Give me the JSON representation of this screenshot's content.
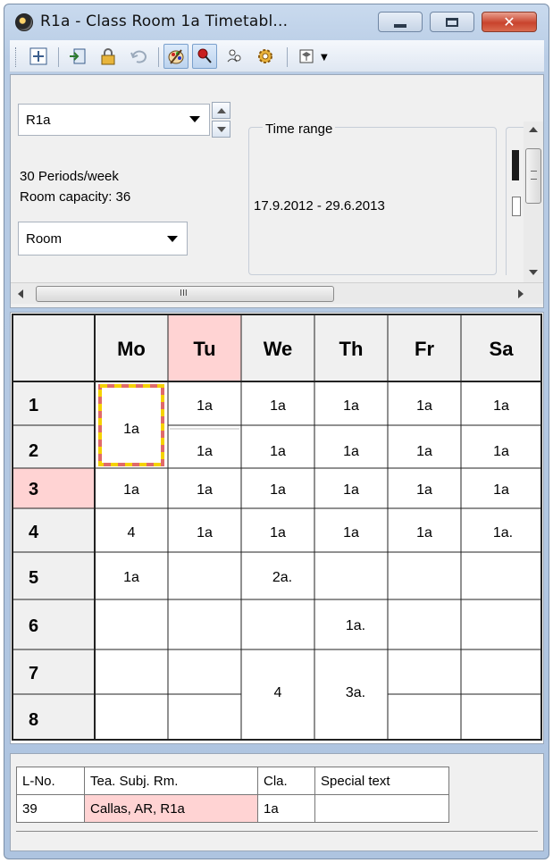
{
  "window": {
    "title": "R1a - Class Room 1a  Timetabl...",
    "buttons": {
      "minimize": "–",
      "maximize": "□",
      "close": "✕"
    }
  },
  "toolbar": {
    "icons": [
      "grid-plus-icon",
      "export-icon",
      "lock-icon",
      "undo-icon",
      "color-palette-icon",
      "pin-icon",
      "users-icon",
      "gear-icon",
      "hat-icon"
    ]
  },
  "room": {
    "selected": "R1a",
    "periods_per_week": "30  Periods/week",
    "capacity": "Room capacity: 36",
    "view_type": "Room"
  },
  "time_range": {
    "label": "Time range",
    "value": "17.9.2012 - 29.6.2013"
  },
  "scrollbar": {
    "h_grip": "III"
  },
  "timetable": {
    "days": [
      "Mo",
      "Tu",
      "We",
      "Th",
      "Fr",
      "Sa"
    ],
    "highlighted_day": "Tu",
    "periods": [
      "1",
      "2",
      "3",
      "4",
      "5",
      "6",
      "7",
      "8"
    ],
    "highlighted_period": "3",
    "cells": {
      "mo_1_2": "1a",
      "mo_3": "1a",
      "mo_4": "4",
      "mo_5": "1a",
      "tu_1": "1a",
      "tu_2": "1a",
      "tu_3": "1a",
      "tu_4": "1a",
      "we_1": "1a",
      "we_2": "1a",
      "we_3": "1a",
      "we_4": "1a",
      "we_5": "2a.",
      "we_7_8": "4",
      "th_1": "1a",
      "th_2": "1a",
      "th_3": "1a",
      "th_4": "1a",
      "th_6": "1a.",
      "th_7_8": "3a.",
      "fr_1": "1a",
      "fr_2": "1a",
      "fr_3": "1a",
      "fr_4": "1a",
      "sa_1": "1a",
      "sa_2": "1a",
      "sa_3": "1a",
      "sa_4": "1a."
    }
  },
  "lesson_table": {
    "headers": [
      "L-No.",
      "Tea. Subj. Rm.",
      "Cla.",
      "Special text"
    ],
    "row": [
      "39",
      "Callas, AR, R1a",
      "1a",
      ""
    ]
  },
  "colors": {
    "highlight_pink": "#ffd3d3",
    "selection_red": "#e06a6a",
    "selection_yellow": "#f5d200"
  }
}
